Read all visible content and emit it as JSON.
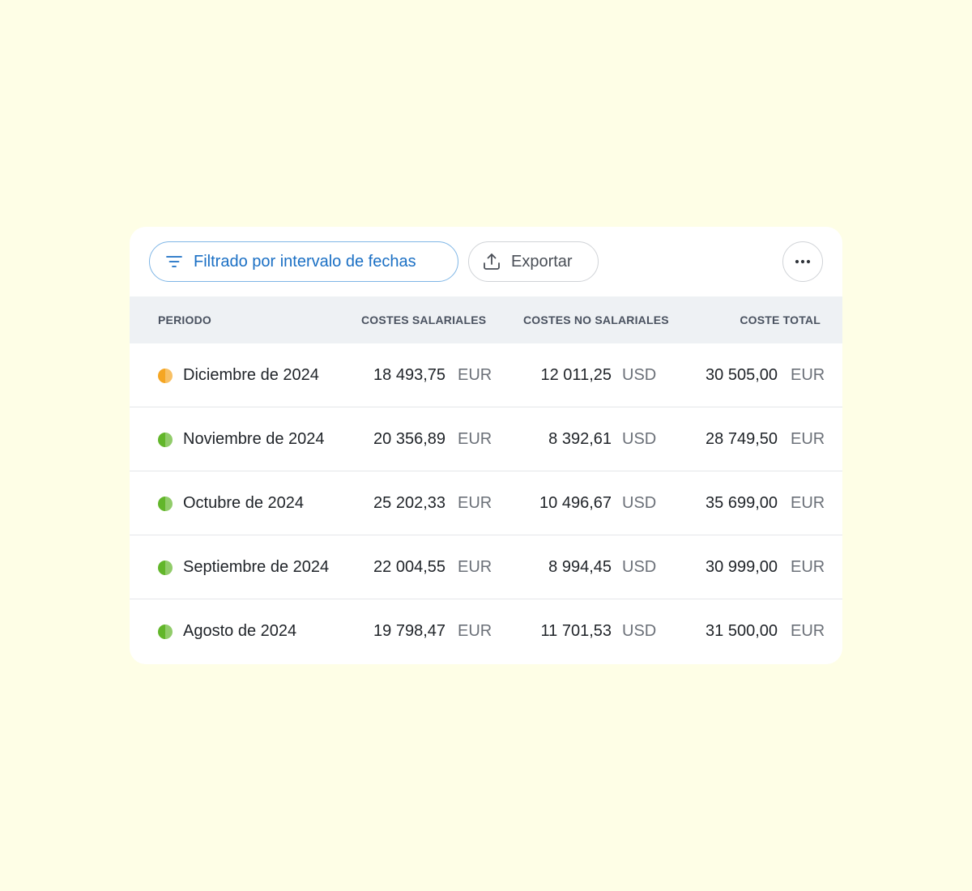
{
  "toolbar": {
    "filter_label": "Filtrado por intervalo de fechas",
    "export_label": "Exportar",
    "filter_icon": "filter-icon",
    "export_icon": "upload-icon",
    "more_icon": "more-horizontal-icon"
  },
  "colors": {
    "accent": "#1a6fc4",
    "status_pending": "#f5a623",
    "status_done": "#62b62a",
    "page_background": "#fefee6"
  },
  "table": {
    "headers": {
      "period": "PERIODO",
      "salary_costs": "COSTES SALARIALES",
      "non_salary_costs": "COSTES NO SALARIALES",
      "total_cost": "COSTE TOTAL"
    },
    "rows": [
      {
        "period": "Diciembre de 2024",
        "status": "pending",
        "salary": "18 493,75",
        "salary_cur": "EUR",
        "non_salary": "12 011,25",
        "non_salary_cur": "USD",
        "total": "30 505,00",
        "total_cur": "EUR"
      },
      {
        "period": "Noviembre de 2024",
        "status": "done",
        "salary": "20 356,89",
        "salary_cur": "EUR",
        "non_salary": "8 392,61",
        "non_salary_cur": "USD",
        "total": "28 749,50",
        "total_cur": "EUR"
      },
      {
        "period": "Octubre de 2024",
        "status": "done",
        "salary": "25 202,33",
        "salary_cur": "EUR",
        "non_salary": "10 496,67",
        "non_salary_cur": "USD",
        "total": "35 699,00",
        "total_cur": "EUR"
      },
      {
        "period": "Septiembre de 2024",
        "status": "done",
        "salary": "22 004,55",
        "salary_cur": "EUR",
        "non_salary": "8 994,45",
        "non_salary_cur": "USD",
        "total": "30 999,00",
        "total_cur": "EUR"
      },
      {
        "period": "Agosto de 2024",
        "status": "done",
        "salary": "19 798,47",
        "salary_cur": "EUR",
        "non_salary": "11 701,53",
        "non_salary_cur": "USD",
        "total": "31 500,00",
        "total_cur": "EUR"
      }
    ]
  }
}
